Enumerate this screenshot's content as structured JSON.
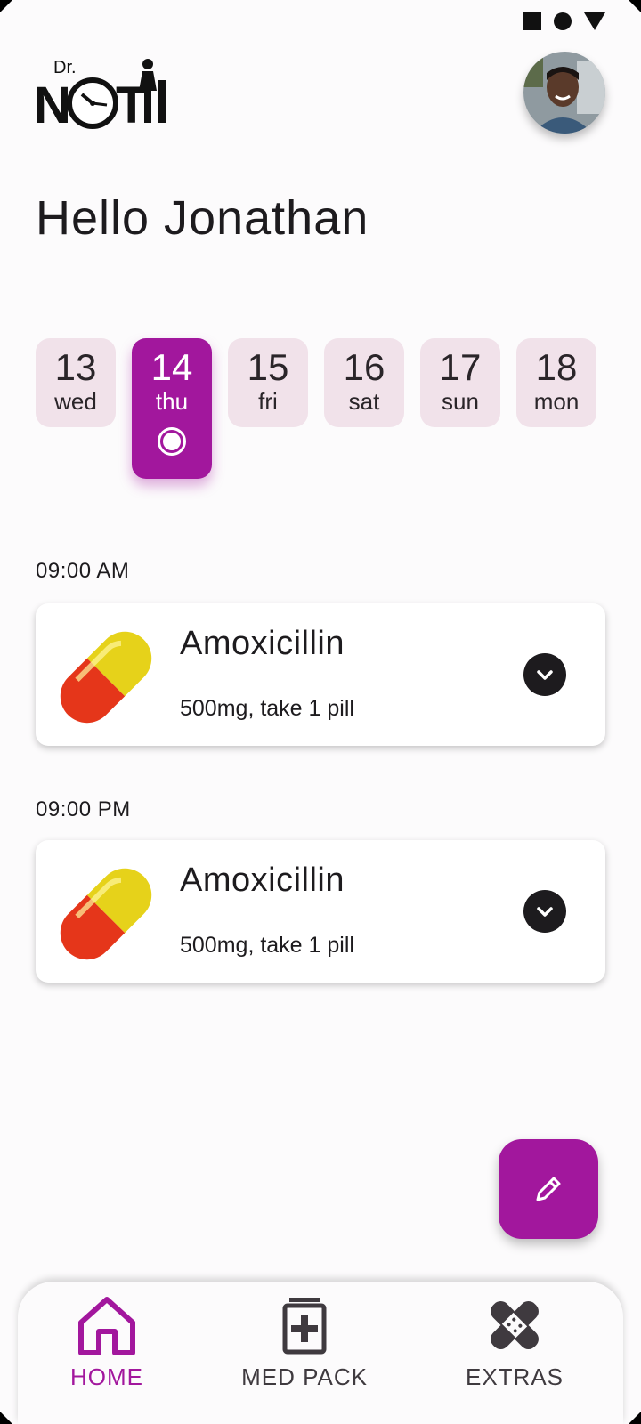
{
  "status_bar": {
    "icons": [
      "square-icon",
      "circle-icon",
      "triangle-icon"
    ]
  },
  "header": {
    "logo_text": "Dr. NOTII",
    "avatar": "user-avatar"
  },
  "greeting": "Hello Jonathan",
  "days": [
    {
      "num": "13",
      "dow": "wed",
      "selected": false
    },
    {
      "num": "14",
      "dow": "thu",
      "selected": true
    },
    {
      "num": "15",
      "dow": "fri",
      "selected": false
    },
    {
      "num": "16",
      "dow": "sat",
      "selected": false
    },
    {
      "num": "17",
      "dow": "sun",
      "selected": false
    },
    {
      "num": "18",
      "dow": "mon",
      "selected": false
    }
  ],
  "schedule": [
    {
      "time": "09:00 AM",
      "name": "Amoxicillin",
      "dose": "500mg, take 1 pill",
      "icon": "pill-capsule-icon"
    },
    {
      "time": "09:00 PM",
      "name": "Amoxicillin",
      "dose": "500mg, take 1 pill",
      "icon": "pill-capsule-icon"
    }
  ],
  "fab": {
    "icon": "pencil-icon"
  },
  "nav": [
    {
      "label": "HOME",
      "icon": "home-icon",
      "active": true
    },
    {
      "label": "MED PACK",
      "icon": "med-pack-icon",
      "active": false
    },
    {
      "label": "EXTRAS",
      "icon": "bandage-icon",
      "active": false
    }
  ],
  "colors": {
    "accent": "#a2179d",
    "day_bg": "#f1e2ea",
    "text": "#1d1b1e",
    "background": "#fcfbfc"
  }
}
